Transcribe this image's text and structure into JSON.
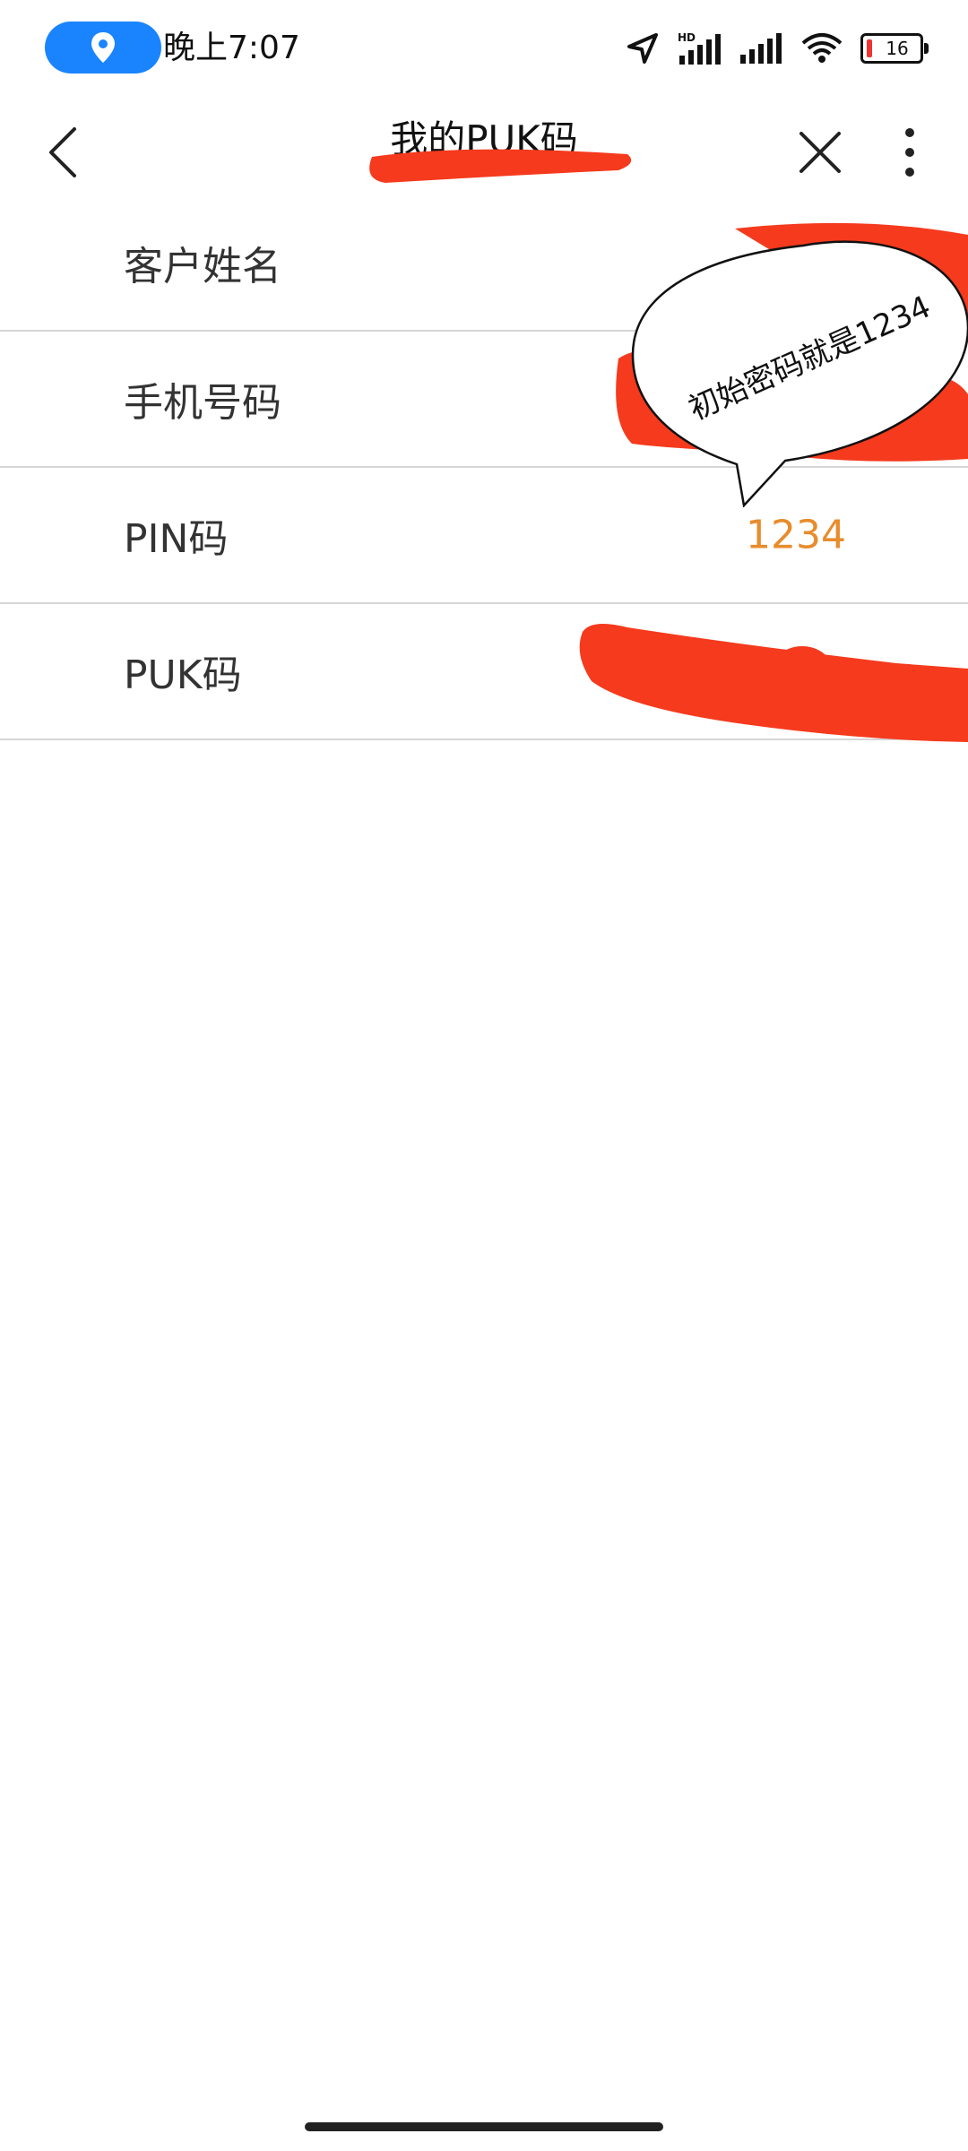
{
  "status_bar": {
    "time": "晚上7:07",
    "battery": "16",
    "icons": [
      "location-icon",
      "navigation-icon",
      "hd-signal-icon",
      "signal-icon",
      "wifi-icon",
      "battery-icon"
    ]
  },
  "header": {
    "title": "我的PUK码"
  },
  "rows": [
    {
      "label": "客户姓名",
      "value": ""
    },
    {
      "label": "手机号码",
      "value": ""
    },
    {
      "label": "PIN码",
      "value": "1234"
    },
    {
      "label": "PUK码",
      "value": ""
    }
  ],
  "annotation": {
    "text": "初始密码就是1234"
  },
  "colors": {
    "value": "#e88c2c",
    "accent_blue": "#1a84ff",
    "redact": "#f53a1d"
  }
}
